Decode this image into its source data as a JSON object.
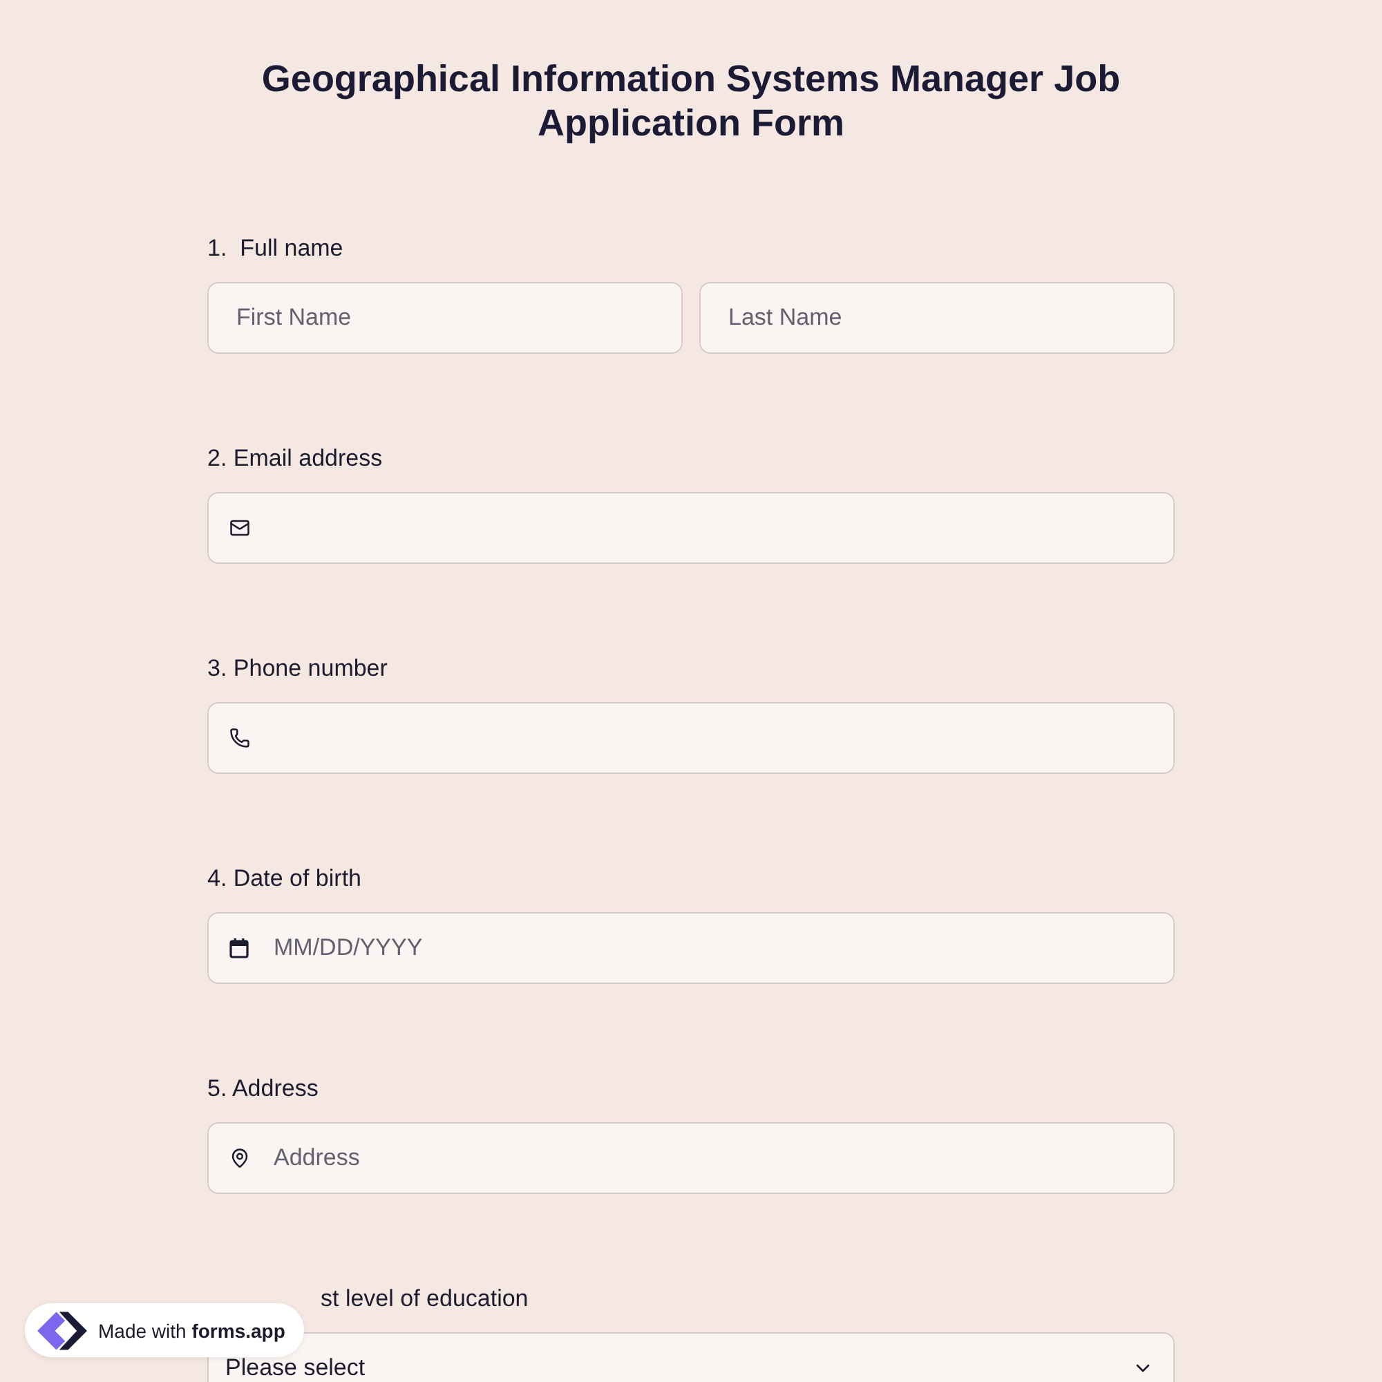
{
  "title": "Geographical Information Systems Manager Job Application Form",
  "questions": [
    {
      "label": "1.  Full name",
      "kind": "name",
      "fields": [
        {
          "placeholder": "First Name"
        },
        {
          "placeholder": "Last Name"
        }
      ]
    },
    {
      "label": "2. Email address",
      "kind": "email"
    },
    {
      "label": "3. Phone number",
      "kind": "phone"
    },
    {
      "label": "4. Date of birth",
      "kind": "date",
      "placeholder": "MM/DD/YYYY"
    },
    {
      "label": "5. Address",
      "kind": "address",
      "placeholder": "Address"
    },
    {
      "label": "st level of education",
      "kind": "select",
      "value": "Please select"
    }
  ],
  "badge": {
    "text": "Made with **forms.app**"
  }
}
